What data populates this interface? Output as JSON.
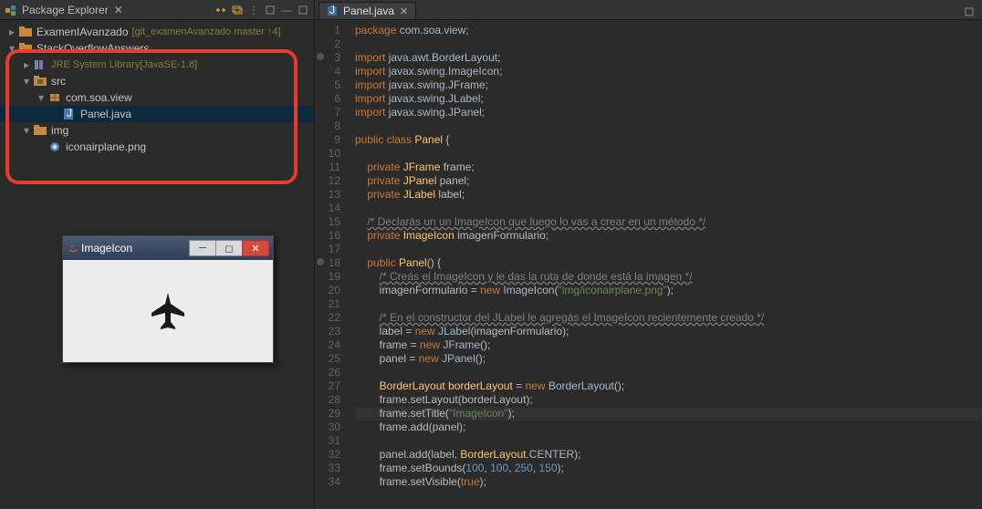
{
  "explorer": {
    "title": "Package Explorer",
    "items": [
      {
        "level": 0,
        "twist": "▸",
        "icon": "proj",
        "label": "ExamenIAvanzado",
        "deco": "[git_examenAvanzado master ↑4]",
        "sel": false
      },
      {
        "level": 0,
        "twist": "▾",
        "icon": "proj",
        "label": "StackOverflowAnswers",
        "deco": "",
        "sel": false
      },
      {
        "level": 1,
        "twist": "▸",
        "icon": "lib",
        "label": "JRE System Library",
        "deco": "[JavaSE-1.8]",
        "sel": false,
        "libstyle": true
      },
      {
        "level": 1,
        "twist": "▾",
        "icon": "srcf",
        "label": "src",
        "deco": "",
        "sel": false
      },
      {
        "level": 2,
        "twist": "▾",
        "icon": "pkg",
        "label": "com.soa.view",
        "deco": "",
        "sel": false
      },
      {
        "level": 3,
        "twist": "",
        "icon": "java",
        "label": "Panel.java",
        "deco": "",
        "sel": true
      },
      {
        "level": 1,
        "twist": "▾",
        "icon": "fold",
        "label": "img",
        "deco": "",
        "sel": false
      },
      {
        "level": 2,
        "twist": "",
        "icon": "file",
        "label": "iconairplane.png",
        "deco": "",
        "sel": false
      }
    ]
  },
  "editor_tab": {
    "label": "Panel.java"
  },
  "preview_win": {
    "title": "ImageIcon"
  },
  "code": [
    {
      "n": 1,
      "hl": false,
      "t": [
        [
          "kw",
          "package "
        ],
        [
          "typ",
          "com.soa.view"
        ],
        [
          "p",
          ";"
        ]
      ]
    },
    {
      "n": 2,
      "hl": false,
      "t": []
    },
    {
      "n": 3,
      "hl": false,
      "m": true,
      "t": [
        [
          "kw",
          "import "
        ],
        [
          "typ",
          "java.awt.BorderLayout"
        ],
        [
          "p",
          ";"
        ]
      ]
    },
    {
      "n": 4,
      "hl": false,
      "t": [
        [
          "kw",
          "import "
        ],
        [
          "typ",
          "javax.swing.ImageIcon"
        ],
        [
          "p",
          ";"
        ]
      ]
    },
    {
      "n": 5,
      "hl": false,
      "t": [
        [
          "kw",
          "import "
        ],
        [
          "typ",
          "javax.swing.JFrame"
        ],
        [
          "p",
          ";"
        ]
      ]
    },
    {
      "n": 6,
      "hl": false,
      "t": [
        [
          "kw",
          "import "
        ],
        [
          "typ",
          "javax.swing.JLabel"
        ],
        [
          "p",
          ";"
        ]
      ]
    },
    {
      "n": 7,
      "hl": false,
      "t": [
        [
          "kw",
          "import "
        ],
        [
          "typ",
          "javax.swing.JPanel"
        ],
        [
          "p",
          ";"
        ]
      ]
    },
    {
      "n": 8,
      "hl": false,
      "t": []
    },
    {
      "n": 9,
      "hl": false,
      "t": [
        [
          "kw",
          "public class "
        ],
        [
          "cls",
          "Panel"
        ],
        [
          "p",
          " {"
        ]
      ]
    },
    {
      "n": 10,
      "hl": false,
      "t": []
    },
    {
      "n": 11,
      "hl": false,
      "t": [
        [
          "p",
          "    "
        ],
        [
          "kw",
          "private "
        ],
        [
          "cls",
          "JFrame"
        ],
        [
          "p",
          " frame;"
        ]
      ]
    },
    {
      "n": 12,
      "hl": false,
      "t": [
        [
          "p",
          "    "
        ],
        [
          "kw",
          "private "
        ],
        [
          "cls",
          "JPanel"
        ],
        [
          "p",
          " panel;"
        ]
      ]
    },
    {
      "n": 13,
      "hl": false,
      "t": [
        [
          "p",
          "    "
        ],
        [
          "kw",
          "private "
        ],
        [
          "cls",
          "JLabel"
        ],
        [
          "p",
          " label;"
        ]
      ]
    },
    {
      "n": 14,
      "hl": false,
      "t": []
    },
    {
      "n": 15,
      "hl": false,
      "t": [
        [
          "p",
          "    "
        ],
        [
          "cmtund",
          "/* Declarás un un ImageIcon que luego lo vas a crear en un método */"
        ]
      ]
    },
    {
      "n": 16,
      "hl": false,
      "t": [
        [
          "p",
          "    "
        ],
        [
          "kw",
          "private "
        ],
        [
          "cls",
          "ImageIcon"
        ],
        [
          "p",
          " imagenFormulario;"
        ]
      ]
    },
    {
      "n": 17,
      "hl": false,
      "t": []
    },
    {
      "n": 18,
      "hl": false,
      "m": true,
      "t": [
        [
          "p",
          "    "
        ],
        [
          "kw",
          "public "
        ],
        [
          "cls",
          "Panel"
        ],
        [
          "p",
          "() {"
        ]
      ]
    },
    {
      "n": 19,
      "hl": false,
      "t": [
        [
          "p",
          "        "
        ],
        [
          "cmtund",
          "/* Creás el ImageIcon y le das la ruta de donde está la imagen */"
        ]
      ]
    },
    {
      "n": 20,
      "hl": false,
      "t": [
        [
          "p",
          "        imagenFormulario = "
        ],
        [
          "kw",
          "new "
        ],
        [
          "typ",
          "ImageIcon"
        ],
        [
          "p",
          "("
        ],
        [
          "str",
          "\"img/iconairplane.png\""
        ],
        [
          "p",
          ");"
        ]
      ]
    },
    {
      "n": 21,
      "hl": false,
      "t": []
    },
    {
      "n": 22,
      "hl": false,
      "t": [
        [
          "p",
          "        "
        ],
        [
          "cmtund",
          "/* En el constructor del JLabel le agregás el ImageIcon recientemente creado */"
        ]
      ]
    },
    {
      "n": 23,
      "hl": false,
      "t": [
        [
          "p",
          "        label = "
        ],
        [
          "kw",
          "new "
        ],
        [
          "typ",
          "JLabel"
        ],
        [
          "p",
          "(imagenFormulario);"
        ]
      ]
    },
    {
      "n": 24,
      "hl": false,
      "t": [
        [
          "p",
          "        frame = "
        ],
        [
          "kw",
          "new "
        ],
        [
          "typ",
          "JFrame"
        ],
        [
          "p",
          "();"
        ]
      ]
    },
    {
      "n": 25,
      "hl": false,
      "t": [
        [
          "p",
          "        panel = "
        ],
        [
          "kw",
          "new "
        ],
        [
          "typ",
          "JPanel"
        ],
        [
          "p",
          "();"
        ]
      ]
    },
    {
      "n": 26,
      "hl": false,
      "t": []
    },
    {
      "n": 27,
      "hl": false,
      "t": [
        [
          "p",
          "        "
        ],
        [
          "cls",
          "BorderLayout"
        ],
        [
          "p",
          " "
        ],
        [
          "cls",
          "borderLayout"
        ],
        [
          "p",
          " = "
        ],
        [
          "kw",
          "new "
        ],
        [
          "typ",
          "BorderLayout"
        ],
        [
          "p",
          "();"
        ]
      ]
    },
    {
      "n": 28,
      "hl": false,
      "t": [
        [
          "p",
          "        frame.setLayout("
        ],
        [
          "ann",
          "borderLayout"
        ],
        [
          "p",
          ");"
        ]
      ]
    },
    {
      "n": 29,
      "hl": true,
      "t": [
        [
          "p",
          "        frame.setTitle("
        ],
        [
          "str",
          "\"ImageIcon\""
        ],
        [
          "p",
          ");"
        ]
      ]
    },
    {
      "n": 30,
      "hl": false,
      "t": [
        [
          "p",
          "        frame.add(panel);"
        ]
      ]
    },
    {
      "n": 31,
      "hl": false,
      "t": []
    },
    {
      "n": 32,
      "hl": false,
      "t": [
        [
          "p",
          "        panel.add(label, "
        ],
        [
          "cls",
          "BorderLayout"
        ],
        [
          "p",
          "."
        ],
        [
          "typ",
          "CENTER"
        ],
        [
          "p",
          ");"
        ]
      ]
    },
    {
      "n": 33,
      "hl": false,
      "t": [
        [
          "p",
          "        frame.setBounds("
        ],
        [
          "num",
          "100"
        ],
        [
          "p",
          ", "
        ],
        [
          "num",
          "100"
        ],
        [
          "p",
          ", "
        ],
        [
          "num",
          "250"
        ],
        [
          "p",
          ", "
        ],
        [
          "num",
          "150"
        ],
        [
          "p",
          ");"
        ]
      ]
    },
    {
      "n": 34,
      "hl": false,
      "t": [
        [
          "p",
          "        frame.setVisible("
        ],
        [
          "kw",
          "true"
        ],
        [
          "p",
          ");"
        ]
      ]
    }
  ]
}
